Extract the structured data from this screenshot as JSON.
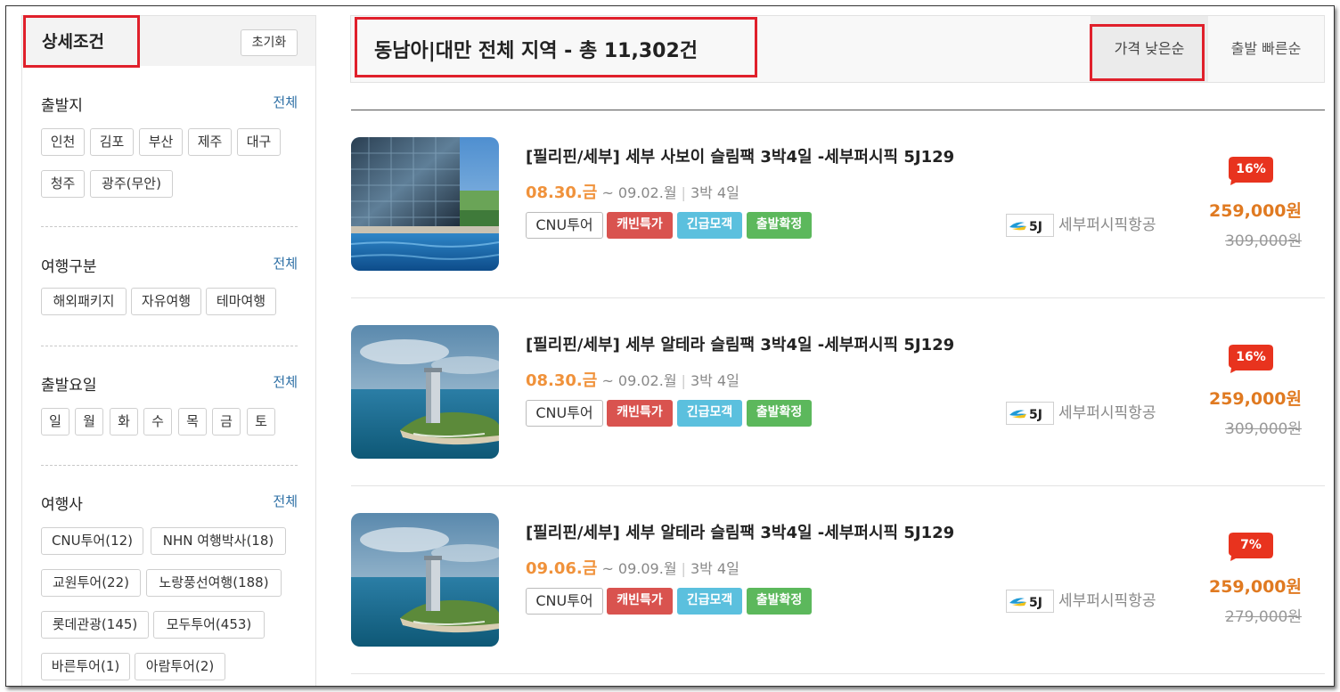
{
  "sidebar": {
    "title": "상세조건",
    "reset_label": "초기화",
    "sections": [
      {
        "title": "출발지",
        "all_label": "전체",
        "chips": [
          "인천",
          "김포",
          "부산",
          "제주",
          "대구",
          "청주",
          "광주(무안)"
        ]
      },
      {
        "title": "여행구분",
        "all_label": "전체",
        "chips": [
          "해외패키지",
          "자유여행",
          "테마여행"
        ]
      },
      {
        "title": "출발요일",
        "all_label": "전체",
        "chips": [
          "일",
          "월",
          "화",
          "수",
          "목",
          "금",
          "토"
        ]
      },
      {
        "title": "여행사",
        "all_label": "전체",
        "chips": [
          "CNU투어(12)",
          "NHN 여행박사(18)",
          "교원투어(22)",
          "노랑풍선여행(188)",
          "롯데관광(145)",
          "모두투어(453)",
          "바른투어(1)",
          "아람투어(2)"
        ]
      }
    ]
  },
  "header": {
    "result_title": "동남아|대만 전체 지역 - 총 11,302건",
    "sort_options": [
      "가격 낮은순",
      "출발 빠른순"
    ],
    "active_sort": "가격 낮은순"
  },
  "items": [
    {
      "title": "[필리핀/세부] 세부 사보이 슬림팩 3박4일 -세부퍼시픽 5J129",
      "date_start": "08.30.금",
      "date_end": "~ 09.02.월",
      "duration": "3박 4일",
      "tags": [
        "CNU투어",
        "캐빈특가",
        "긴급모객",
        "출발확정"
      ],
      "airline_code": "5J",
      "airline_name": "세부퍼시픽항공",
      "discount": "16%",
      "price": "259,000원",
      "original_price": "309,000원",
      "image": "hotel-pool"
    },
    {
      "title": "[필리핀/세부] 세부 알테라 슬림팩 3박4일 -세부퍼시픽 5J129",
      "date_start": "08.30.금",
      "date_end": "~ 09.02.월",
      "duration": "3박 4일",
      "tags": [
        "CNU투어",
        "캐빈특가",
        "긴급모객",
        "출발확정"
      ],
      "airline_code": "5J",
      "airline_name": "세부퍼시픽항공",
      "discount": "16%",
      "price": "259,000원",
      "original_price": "309,000원",
      "image": "tower-island"
    },
    {
      "title": "[필리핀/세부] 세부 알테라 슬림팩 3박4일 -세부퍼시픽 5J129",
      "date_start": "09.06.금",
      "date_end": "~ 09.09.월",
      "duration": "3박 4일",
      "tags": [
        "CNU투어",
        "캐빈특가",
        "긴급모객",
        "출발확정"
      ],
      "airline_code": "5J",
      "airline_name": "세부퍼시픽항공",
      "discount": "7%",
      "price": "259,000원",
      "original_price": "279,000원",
      "image": "tower-island"
    }
  ],
  "colors": {
    "highlight": "#e0202b",
    "price": "#e07a21",
    "date_start": "#f0923b",
    "tag_red": "#d9534f",
    "tag_blue": "#5bc0de",
    "tag_green": "#5cb85c",
    "link": "#2d6fa5"
  }
}
